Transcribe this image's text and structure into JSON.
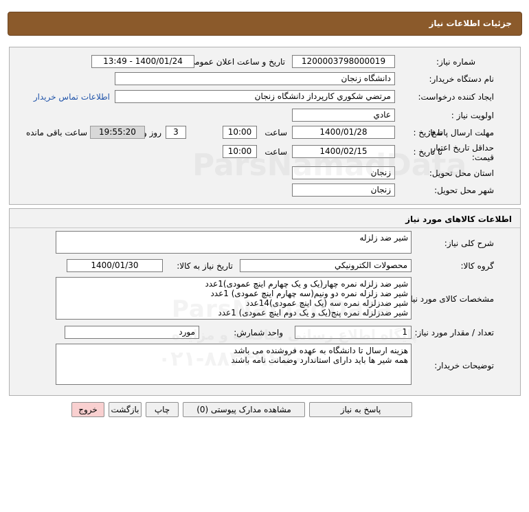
{
  "header": {
    "title": "جزئیات اطلاعات نیاز"
  },
  "need": {
    "need_number_label": "شماره نیاز:",
    "need_number": "1200003798000019",
    "announce_label": "تاریخ و ساعت اعلان عمومی:",
    "announce_value": "1400/01/24 - 13:49",
    "buyer_org_label": "نام دستگاه خریدار:",
    "buyer_org": "دانشگاه زنجان",
    "requester_label": "ایجاد کننده درخواست:",
    "requester": "مرتضي شكوري كارپرداز دانشگاه زنجان",
    "contact_link": "اطلاعات تماس خریدار",
    "priority_label": "اولویت نیاز :",
    "priority": "عادي",
    "deadline_label": "مهلت ارسال پاسخ:",
    "to_date_label": "تا تاریخ :",
    "deadline_date": "1400/01/28",
    "time_label": "ساعت",
    "deadline_time": "10:00",
    "days_value": "3",
    "days_label": "روز و",
    "remaining_time": "19:55:20",
    "remaining_label": "ساعت باقی مانده",
    "validity_label": "حداقل تاریخ اعتبار قیمت:",
    "validity_date": "1400/02/15",
    "validity_time": "10:00",
    "province_label": "استان محل تحویل:",
    "province": "زنجان",
    "city_label": "شهر محل تحویل:",
    "city": "زنجان"
  },
  "goods": {
    "section_title": "اطلاعات کالاهای مورد نیاز",
    "summary_label": "شرح کلی نیاز:",
    "summary": "شیر ضد زلزله",
    "group_label": "گروه کالا:",
    "group": "محصولات الكترونيكي",
    "need_date_label": "تاریخ نیاز به کالا:",
    "need_date": "1400/01/30",
    "specs_label": "مشخصات کالای مورد نیاز:",
    "specs": [
      "شیر ضد زلزله نمره چهار(یک و یک چهارم اینچ عمودی)1عدد",
      "شیر ضد زلزله نمره دو ونیم(سه چهارم اینچ عمودی) 1عدد",
      "شیر ضدزلزله نمره سه (یک اینچ عمودی)14عدد",
      "شیر ضدزلزله نمره پنج(یک و یک دوم اینچ عمودی) 1عدد"
    ],
    "qty_label": "تعداد / مقدار مورد نیاز:",
    "qty": "1",
    "unit_label": "واحد شمارش:",
    "unit": "مورد",
    "notes_label": "توضیحات خریدار:",
    "notes": [
      "هزینه ارسال تا دانشگاه به عهده فروشنده می باشد",
      "همه شیر ها باید دارای استاندارد وضمانت نامه باشند"
    ]
  },
  "buttons": {
    "reply": "پاسخ به نیاز",
    "attachments": "مشاهده مدارک پیوستی (0)",
    "print": "چاپ",
    "back": "بازگشت",
    "exit": "خروج"
  },
  "watermark": {
    "line1": "ParsNamadData",
    "line2": "پایگاه اطلاع رسانی مناقصه و مزایده",
    "line3": "۰۲۱-۸۸۳۴۹۶۷۰"
  }
}
